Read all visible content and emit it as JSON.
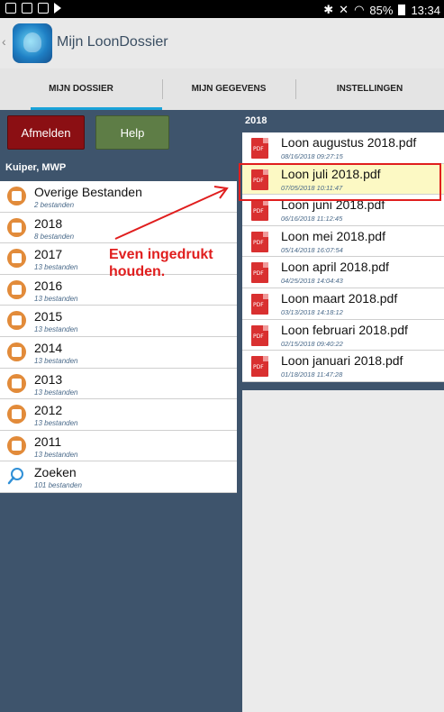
{
  "status_bar": {
    "battery": "85%",
    "time": "13:34"
  },
  "app": {
    "title": "Mijn LoonDossier"
  },
  "tabs": [
    {
      "label": "MIJN DOSSIER"
    },
    {
      "label": "MIJN GEGEVENS"
    },
    {
      "label": "INSTELLINGEN"
    }
  ],
  "buttons": {
    "logout": "Afmelden",
    "help": "Help"
  },
  "user": "Kuiper, MWP",
  "folders": [
    {
      "name": "Overige Bestanden",
      "count": "2 bestanden"
    },
    {
      "name": "2018",
      "count": "8 bestanden"
    },
    {
      "name": "2017",
      "count": "13 bestanden"
    },
    {
      "name": "2016",
      "count": "13 bestanden"
    },
    {
      "name": "2015",
      "count": "13 bestanden"
    },
    {
      "name": "2014",
      "count": "13 bestanden"
    },
    {
      "name": "2013",
      "count": "13 bestanden"
    },
    {
      "name": "2012",
      "count": "13 bestanden"
    },
    {
      "name": "2011",
      "count": "13 bestanden"
    },
    {
      "name": "Zoeken",
      "count": "101 bestanden"
    }
  ],
  "year": "2018",
  "files": [
    {
      "name": "Loon augustus 2018.pdf",
      "date": "08/16/2018 09:27:15"
    },
    {
      "name": "Loon juli 2018.pdf",
      "date": "07/05/2018 10:11:47"
    },
    {
      "name": "Loon juni 2018.pdf",
      "date": "06/16/2018 11:12:45"
    },
    {
      "name": "Loon mei 2018.pdf",
      "date": "05/14/2018 16:07:54"
    },
    {
      "name": "Loon april 2018.pdf",
      "date": "04/25/2018 14:04:43"
    },
    {
      "name": "Loon maart 2018.pdf",
      "date": "03/13/2018 14:18:12"
    },
    {
      "name": "Loon februari 2018.pdf",
      "date": "02/15/2018 09:40:22"
    },
    {
      "name": "Loon januari 2018.pdf",
      "date": "01/18/2018 11:47:28"
    }
  ],
  "annotation": {
    "line1": "Even ingedrukt",
    "line2": "houden."
  },
  "colors": {
    "accent": "#1aa3d9",
    "background": "#3e546c",
    "annotation": "#e01e1e",
    "logout": "#8b0f13",
    "help": "#5e7d46",
    "folder_icon": "#e28b3a",
    "pdf_icon": "#d93030"
  }
}
